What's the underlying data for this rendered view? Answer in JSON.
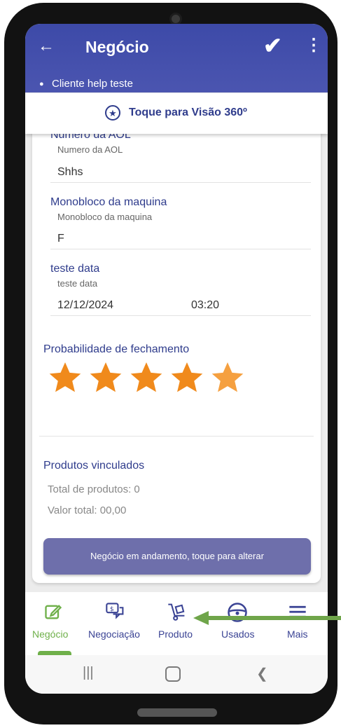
{
  "appbar": {
    "title": "Negócio",
    "client": "Cliente help teste"
  },
  "visao": {
    "label": "Toque para Visão 360º"
  },
  "fields": [
    {
      "label": "Numero da AOL",
      "sublabel": "Numero da AOL",
      "value": "Shhs"
    },
    {
      "label": "Monobloco da maquina",
      "sublabel": "Monobloco da maquina",
      "value": "F"
    },
    {
      "label": "teste data",
      "sublabel": "teste data",
      "date": "12/12/2024",
      "time": "03:20"
    }
  ],
  "probability": {
    "label": "Probabilidade de fechamento",
    "rating": 5,
    "max": 5,
    "star_color": "#f08a1c"
  },
  "produtos": {
    "title": "Produtos vinculados",
    "total": "Total de produtos: 0",
    "valor": "Valor total: 00,00"
  },
  "status_button": "Negócio em andamento, toque para alterar",
  "bottom_nav": [
    {
      "label": "Negócio",
      "icon": "edit-icon",
      "active": true
    },
    {
      "label": "Negociação",
      "icon": "money-chat-icon",
      "active": false
    },
    {
      "label": "Produto",
      "icon": "hand-truck-icon",
      "active": false
    },
    {
      "label": "Usados",
      "icon": "steering-wheel-icon",
      "active": false
    },
    {
      "label": "Mais",
      "icon": "menu-icon",
      "active": false
    }
  ],
  "colors": {
    "appbar": "#3d4aa8",
    "accent": "#2f3c8c",
    "active": "#6fb04a",
    "arrow": "#6fa54a"
  }
}
